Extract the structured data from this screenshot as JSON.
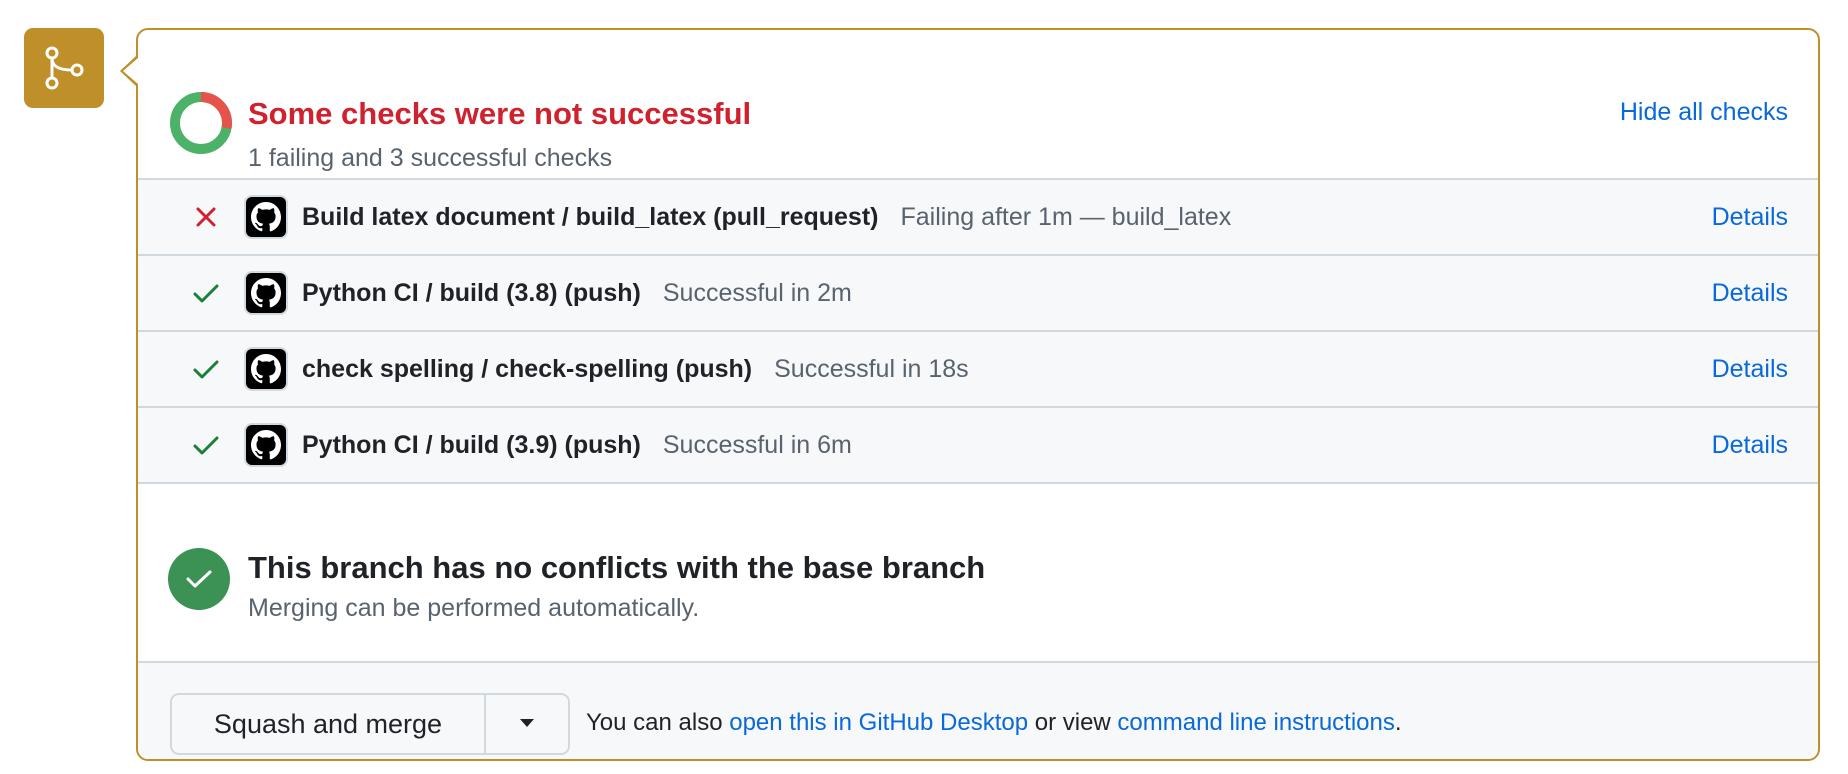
{
  "colors": {
    "accent_border": "#bf8f2a",
    "fail_red": "#cf222e",
    "success_green": "#1a7f37",
    "link_blue": "#0969da"
  },
  "merge_icon": "git-merge-icon",
  "status": {
    "title": "Some checks were not successful",
    "subtitle": "1 failing and 3 successful checks",
    "hide_link": "Hide all checks",
    "failing_count": 1,
    "successful_count": 3
  },
  "checks": [
    {
      "status": "failure",
      "status_icon": "x-icon",
      "avatar_icon": "github-icon",
      "name": "Build latex document / build_latex (pull_request)",
      "description": "Failing after 1m — build_latex",
      "details": "Details"
    },
    {
      "status": "success",
      "status_icon": "check-icon",
      "avatar_icon": "github-icon",
      "name": "Python CI / build (3.8) (push)",
      "description": "Successful in 2m",
      "details": "Details"
    },
    {
      "status": "success",
      "status_icon": "check-icon",
      "avatar_icon": "github-icon",
      "name": "check spelling / check-spelling (push)",
      "description": "Successful in 18s",
      "details": "Details"
    },
    {
      "status": "success",
      "status_icon": "check-icon",
      "avatar_icon": "github-icon",
      "name": "Python CI / build (3.9) (push)",
      "description": "Successful in 6m",
      "details": "Details"
    }
  ],
  "conflicts": {
    "icon": "check-circle-icon",
    "title": "This branch has no conflicts with the base branch",
    "subtitle": "Merging can be performed automatically."
  },
  "footer": {
    "merge_button": "Squash and merge",
    "dropdown_icon": "triangle-down-icon",
    "text_prefix": "You can also ",
    "desktop_link": "open this in GitHub Desktop",
    "text_middle": " or view ",
    "cli_link": "command line instructions",
    "text_suffix": "."
  }
}
